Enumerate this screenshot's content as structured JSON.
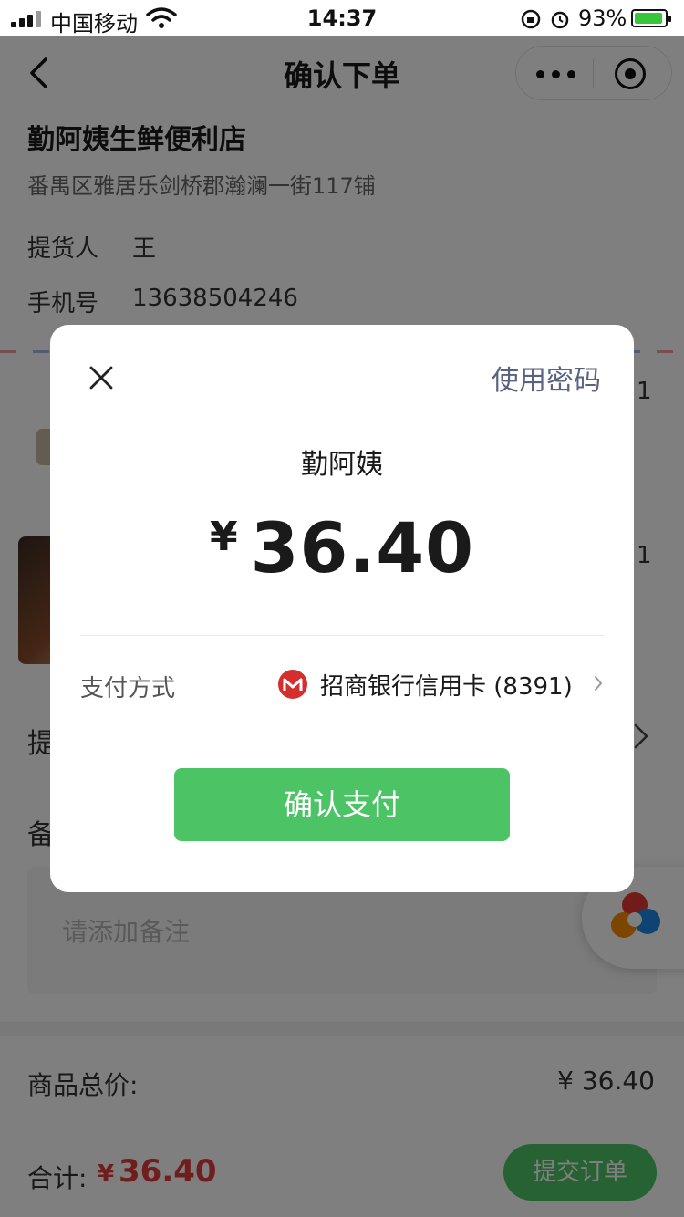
{
  "status_bar": {
    "carrier": "中国移动",
    "time": "14:37",
    "battery": "93%"
  },
  "nav": {
    "title": "确认下单"
  },
  "store": {
    "name": "勤阿姨生鲜便利店",
    "address": "番禺区雅居乐剑桥郡瀚澜一街117铺"
  },
  "pickup": {
    "person_label": "提货人",
    "person_value": "王",
    "phone_label": "手机号",
    "phone_value": "13638504246"
  },
  "items": [
    {
      "qty": "1"
    },
    {
      "qty": "1"
    }
  ],
  "partial_labels": {
    "pickup_time": "提",
    "remark": "备"
  },
  "remark": {
    "placeholder": "请添加备注"
  },
  "summary": {
    "total_label": "商品总价:",
    "total_value": "¥ 36.40",
    "sum_label": "合计:",
    "sum_symbol": "¥",
    "sum_value": "36.40",
    "submit_label": "提交订单"
  },
  "payment_modal": {
    "use_password_label": "使用密码",
    "payee": "勤阿姨",
    "currency_symbol": "¥",
    "amount": "36.40",
    "method_label": "支付方式",
    "bank_name": "招商银行信用卡 (8391)",
    "confirm_label": "确认支付"
  },
  "colors": {
    "accent_green": "#4cc465",
    "price_red": "#e03b3b",
    "link_blue": "#5a6282",
    "bank_red": "#d32f2f"
  }
}
